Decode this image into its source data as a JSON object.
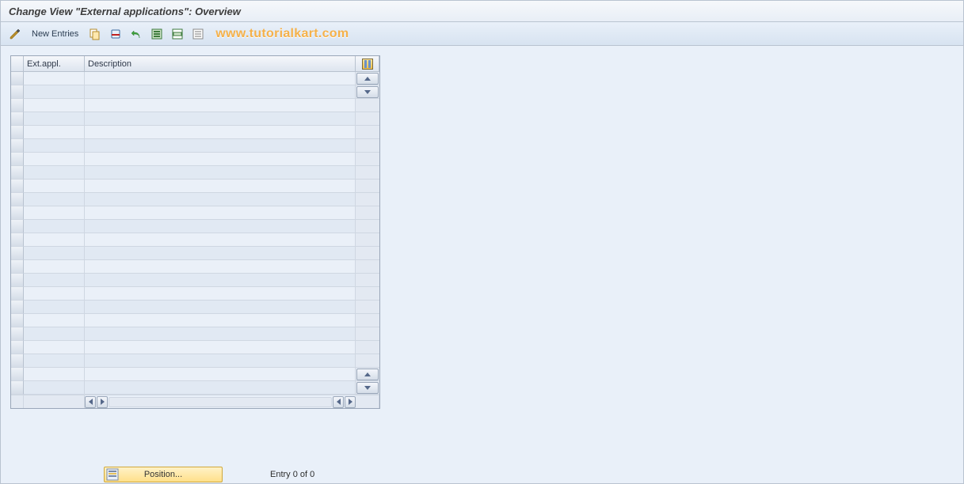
{
  "title": "Change View \"External applications\": Overview",
  "toolbar": {
    "new_entries_label": "New Entries"
  },
  "watermark": "www.tutorialkart.com",
  "table": {
    "columns": [
      "Ext.appl.",
      "Description"
    ],
    "rows": []
  },
  "footer": {
    "position_label": "Position...",
    "entry_text": "Entry 0 of 0"
  }
}
